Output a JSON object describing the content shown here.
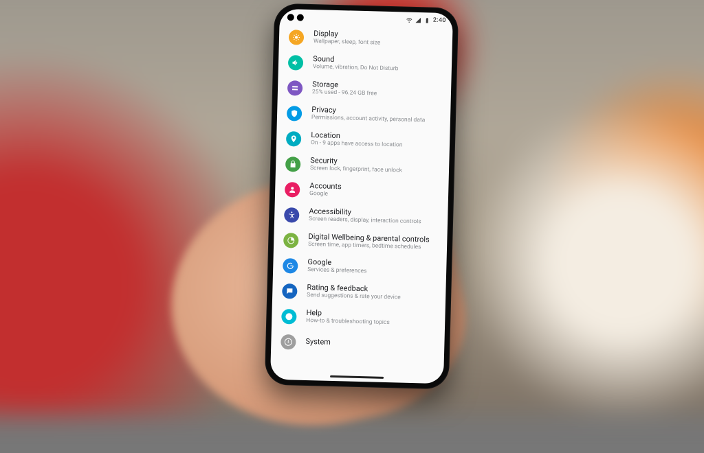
{
  "status": {
    "time": "2:40",
    "wifi": "wifi-icon",
    "signal": "signal-icon",
    "battery": "battery-icon"
  },
  "settings": [
    {
      "icon": "display-icon",
      "color": "#f5a623",
      "title": "Display",
      "sub": "Wallpaper, sleep, font size"
    },
    {
      "icon": "sound-icon",
      "color": "#00bfa5",
      "title": "Sound",
      "sub": "Volume, vibration, Do Not Disturb"
    },
    {
      "icon": "storage-icon",
      "color": "#7e57c2",
      "title": "Storage",
      "sub": "25% used - 96.24 GB free"
    },
    {
      "icon": "privacy-icon",
      "color": "#039be5",
      "title": "Privacy",
      "sub": "Permissions, account activity, personal data"
    },
    {
      "icon": "location-icon",
      "color": "#00acc1",
      "title": "Location",
      "sub": "On - 9 apps have access to location"
    },
    {
      "icon": "security-icon",
      "color": "#43a047",
      "title": "Security",
      "sub": "Screen lock, fingerprint, face unlock"
    },
    {
      "icon": "accounts-icon",
      "color": "#e91e63",
      "title": "Accounts",
      "sub": "Google"
    },
    {
      "icon": "accessibility-icon",
      "color": "#3949ab",
      "title": "Accessibility",
      "sub": "Screen readers, display, interaction controls"
    },
    {
      "icon": "wellbeing-icon",
      "color": "#7cb342",
      "title": "Digital Wellbeing & parental controls",
      "sub": "Screen time, app timers, bedtime schedules"
    },
    {
      "icon": "google-icon",
      "color": "#1e88e5",
      "title": "Google",
      "sub": "Services & preferences"
    },
    {
      "icon": "feedback-icon",
      "color": "#1565c0",
      "title": "Rating & feedback",
      "sub": "Send suggestions & rate your device"
    },
    {
      "icon": "help-icon",
      "color": "#00bcd4",
      "title": "Help",
      "sub": "How-to & troubleshooting topics"
    },
    {
      "icon": "system-icon",
      "color": "#9e9e9e",
      "title": "System",
      "sub": ""
    }
  ]
}
